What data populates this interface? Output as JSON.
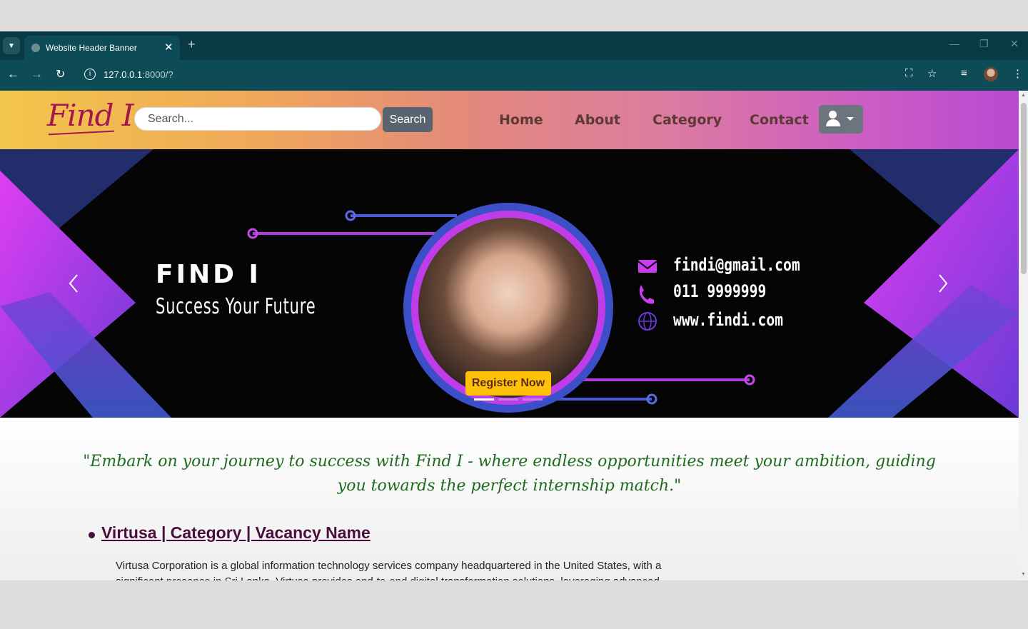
{
  "browser": {
    "tab_title": "Website Header Banner",
    "url_host": "127.0.0.1",
    "url_path": ":8000/?"
  },
  "navbar": {
    "logo": "Find I",
    "search_placeholder": "Search...",
    "search_button": "Search",
    "links": [
      "Home",
      "About",
      "Category",
      "Contact"
    ]
  },
  "banner": {
    "title": "FIND I",
    "subtitle": "Success Your Future",
    "email": "findi@gmail.com",
    "phone": "011 9999999",
    "website": "www.findi.com",
    "register_button": "Register Now",
    "slide_count": 3,
    "active_slide": 1
  },
  "content": {
    "tagline": "\"Embark on your journey to success with Find I - where endless opportunities meet your ambition, guiding you towards the perfect internship match.\"",
    "vacancy_title": "Virtusa | Category | Vacancy Name",
    "vacancy_description": "Virtusa Corporation is a global information technology services company headquartered in the United States, with a significant presence in Sri Lanka. Virtusa provides end-to-end digital transformation solutions, leveraging advanced"
  },
  "colors": {
    "navbar_gradient": [
      "#f2c64b",
      "#e38a7a",
      "#b84ad2"
    ],
    "banner_purple": "#c93cf0",
    "banner_blue": "#4a55c8",
    "register_button": "#ffc107",
    "tagline_text": "#1e6b1e",
    "vacancy_link": "#4a0e3c"
  }
}
